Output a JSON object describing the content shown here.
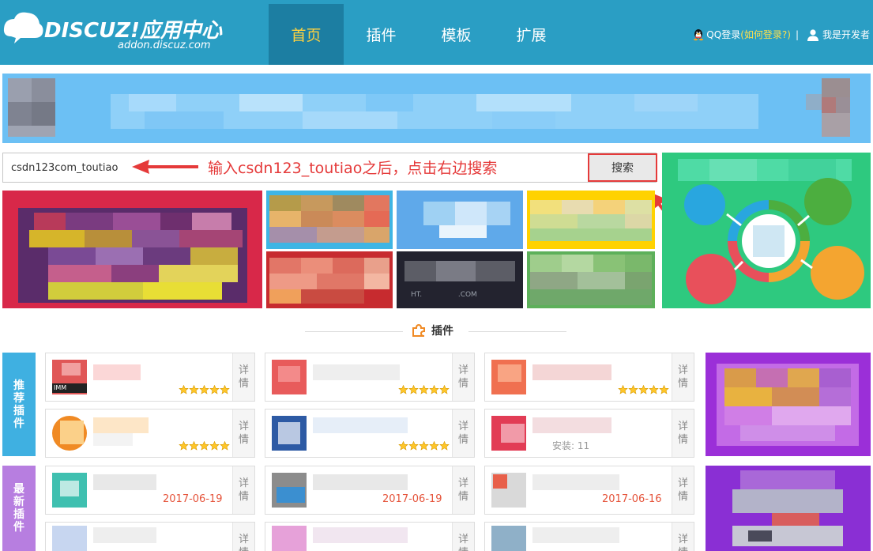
{
  "header": {
    "logo_text": "DISCUZ!应用中心",
    "logo_sub": "addon.discuz.com",
    "nav": [
      {
        "label": "首页",
        "active": true
      },
      {
        "label": "插件",
        "active": false
      },
      {
        "label": "模板",
        "active": false
      },
      {
        "label": "扩展",
        "active": false
      }
    ],
    "qq_login": "QQ登录",
    "qq_help": "(如何登录?)",
    "separator": "|",
    "developer": "我是开发者"
  },
  "search": {
    "value": "csdn123com_toutiao",
    "button_label": "搜索",
    "annotation": "输入csdn123_toutiao之后，点击右边搜索"
  },
  "section": {
    "title": "插件"
  },
  "side_labels": {
    "recommended": "推荐插件",
    "latest": "最新插件"
  },
  "cards": {
    "detail_label": "详情",
    "recommended": [
      {
        "rating": 5,
        "extra": "IMM"
      },
      {
        "rating": 5,
        "extra": ""
      },
      {
        "rating": 5,
        "extra": ""
      },
      {
        "rating": 5,
        "extra": ""
      },
      {
        "rating": 5,
        "extra": ""
      },
      {
        "rating": 0,
        "extra": "安装: 11"
      }
    ],
    "latest": [
      {
        "date": "2017-06-19"
      },
      {
        "date": "2017-06-19"
      },
      {
        "date": "2017-06-16"
      },
      {
        "date": ""
      },
      {
        "date": ""
      },
      {
        "date": ""
      }
    ]
  },
  "tiles": {
    "dark_tile_text": "HT.                .COM"
  },
  "colors": {
    "header_bg": "#2a9ec4",
    "nav_active_bg": "#1c7ea2",
    "nav_active_text": "#ffd23f",
    "annotation_red": "#e53a3a",
    "recommended_label_bg": "#3fb0e1",
    "latest_label_bg": "#b77ee0",
    "date_color": "#e5533a"
  }
}
